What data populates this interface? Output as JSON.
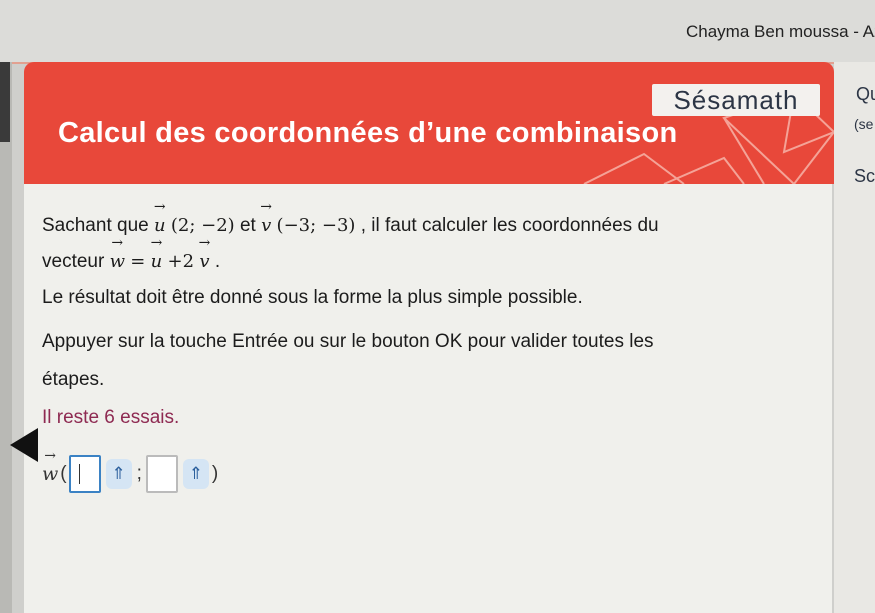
{
  "header": {
    "user_name": "Chayma Ben moussa - Az"
  },
  "banner": {
    "brand": "Sésamath",
    "title": "Calcul des coordonnées d’une combinaison",
    "color": "#e8483a"
  },
  "right_panel": {
    "line1": "Qu",
    "line2": "(se",
    "line3": "Sc"
  },
  "content": {
    "line1_pre": "Sachant que ",
    "u_symbol": "u",
    "u_coords": "(2; −2)",
    "line1_mid": " et ",
    "v_symbol": "v",
    "v_coords": "(−3; −3)",
    "line1_post": ", il faut calculer les coordonnées du",
    "line2_pre": "vecteur ",
    "w_symbol": "w",
    "eq": "=",
    "plus": "+2",
    "period": ".",
    "line3": "Le résultat doit être donné sous la forme la plus simple possible.",
    "line4": "Appuyer sur la touche Entrée ou sur le bouton OK pour valider toutes les",
    "line5": "étapes.",
    "remaining": "Il reste 6 essais."
  },
  "answer": {
    "w_label": "w",
    "open_paren": "(",
    "semicolon": ";",
    "close_paren": ")",
    "expand_symbol": "⇑"
  }
}
